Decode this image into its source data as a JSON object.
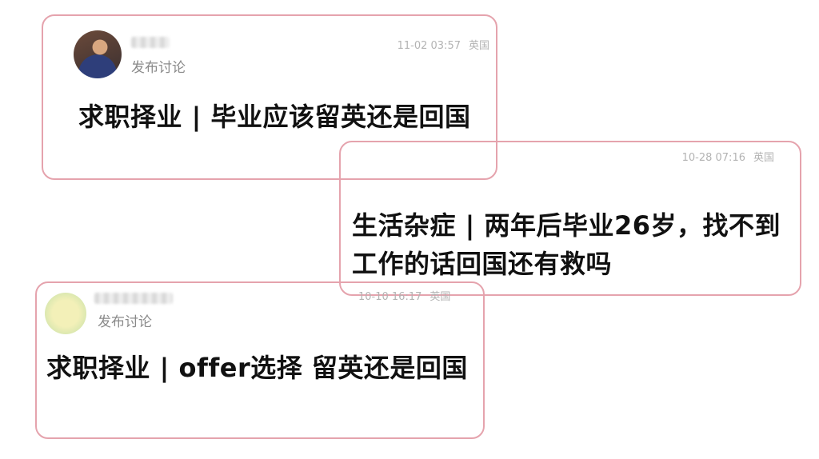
{
  "posts": [
    {
      "action": "发布讨论",
      "time": "11-02 03:57",
      "location": "英国",
      "title": "求职择业 | 毕业应该留英还是回国"
    },
    {
      "action": "",
      "time": "10-28 07:16",
      "location": "英国",
      "title": "生活杂症 | 两年后毕业26岁，找不到工作的话回国还有救吗"
    },
    {
      "action": "发布讨论",
      "time": "10-10 16:17",
      "location": "英国",
      "title": "求职择业 | offer选择 留英还是回国"
    }
  ],
  "colors": {
    "card_border": "#e5a3ad",
    "meta_text": "#b3b3b3",
    "title_text": "#111111"
  }
}
